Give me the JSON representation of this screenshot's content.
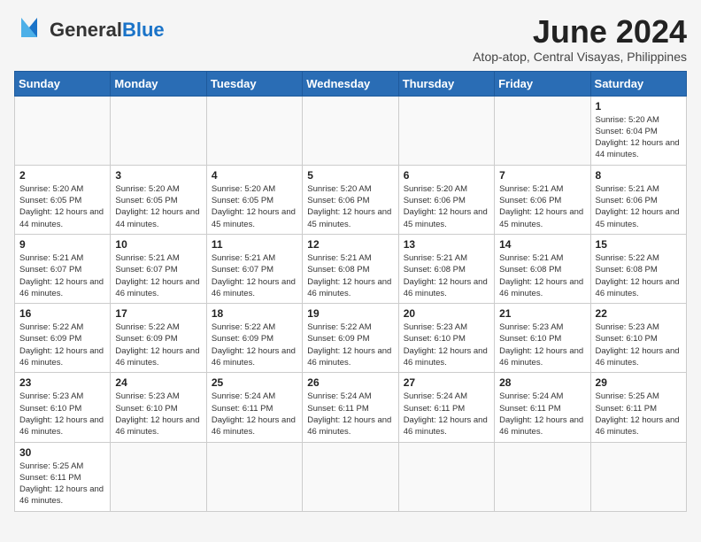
{
  "header": {
    "logo_general": "General",
    "logo_blue": "Blue",
    "month_title": "June 2024",
    "subtitle": "Atop-atop, Central Visayas, Philippines"
  },
  "days_of_week": [
    "Sunday",
    "Monday",
    "Tuesday",
    "Wednesday",
    "Thursday",
    "Friday",
    "Saturday"
  ],
  "weeks": [
    [
      {
        "day": "",
        "info": ""
      },
      {
        "day": "",
        "info": ""
      },
      {
        "day": "",
        "info": ""
      },
      {
        "day": "",
        "info": ""
      },
      {
        "day": "",
        "info": ""
      },
      {
        "day": "",
        "info": ""
      },
      {
        "day": "1",
        "info": "Sunrise: 5:20 AM\nSunset: 6:04 PM\nDaylight: 12 hours and 44 minutes."
      }
    ],
    [
      {
        "day": "2",
        "info": "Sunrise: 5:20 AM\nSunset: 6:05 PM\nDaylight: 12 hours and 44 minutes."
      },
      {
        "day": "3",
        "info": "Sunrise: 5:20 AM\nSunset: 6:05 PM\nDaylight: 12 hours and 44 minutes."
      },
      {
        "day": "4",
        "info": "Sunrise: 5:20 AM\nSunset: 6:05 PM\nDaylight: 12 hours and 45 minutes."
      },
      {
        "day": "5",
        "info": "Sunrise: 5:20 AM\nSunset: 6:06 PM\nDaylight: 12 hours and 45 minutes."
      },
      {
        "day": "6",
        "info": "Sunrise: 5:20 AM\nSunset: 6:06 PM\nDaylight: 12 hours and 45 minutes."
      },
      {
        "day": "7",
        "info": "Sunrise: 5:21 AM\nSunset: 6:06 PM\nDaylight: 12 hours and 45 minutes."
      },
      {
        "day": "8",
        "info": "Sunrise: 5:21 AM\nSunset: 6:06 PM\nDaylight: 12 hours and 45 minutes."
      }
    ],
    [
      {
        "day": "9",
        "info": "Sunrise: 5:21 AM\nSunset: 6:07 PM\nDaylight: 12 hours and 46 minutes."
      },
      {
        "day": "10",
        "info": "Sunrise: 5:21 AM\nSunset: 6:07 PM\nDaylight: 12 hours and 46 minutes."
      },
      {
        "day": "11",
        "info": "Sunrise: 5:21 AM\nSunset: 6:07 PM\nDaylight: 12 hours and 46 minutes."
      },
      {
        "day": "12",
        "info": "Sunrise: 5:21 AM\nSunset: 6:08 PM\nDaylight: 12 hours and 46 minutes."
      },
      {
        "day": "13",
        "info": "Sunrise: 5:21 AM\nSunset: 6:08 PM\nDaylight: 12 hours and 46 minutes."
      },
      {
        "day": "14",
        "info": "Sunrise: 5:21 AM\nSunset: 6:08 PM\nDaylight: 12 hours and 46 minutes."
      },
      {
        "day": "15",
        "info": "Sunrise: 5:22 AM\nSunset: 6:08 PM\nDaylight: 12 hours and 46 minutes."
      }
    ],
    [
      {
        "day": "16",
        "info": "Sunrise: 5:22 AM\nSunset: 6:09 PM\nDaylight: 12 hours and 46 minutes."
      },
      {
        "day": "17",
        "info": "Sunrise: 5:22 AM\nSunset: 6:09 PM\nDaylight: 12 hours and 46 minutes."
      },
      {
        "day": "18",
        "info": "Sunrise: 5:22 AM\nSunset: 6:09 PM\nDaylight: 12 hours and 46 minutes."
      },
      {
        "day": "19",
        "info": "Sunrise: 5:22 AM\nSunset: 6:09 PM\nDaylight: 12 hours and 46 minutes."
      },
      {
        "day": "20",
        "info": "Sunrise: 5:23 AM\nSunset: 6:10 PM\nDaylight: 12 hours and 46 minutes."
      },
      {
        "day": "21",
        "info": "Sunrise: 5:23 AM\nSunset: 6:10 PM\nDaylight: 12 hours and 46 minutes."
      },
      {
        "day": "22",
        "info": "Sunrise: 5:23 AM\nSunset: 6:10 PM\nDaylight: 12 hours and 46 minutes."
      }
    ],
    [
      {
        "day": "23",
        "info": "Sunrise: 5:23 AM\nSunset: 6:10 PM\nDaylight: 12 hours and 46 minutes."
      },
      {
        "day": "24",
        "info": "Sunrise: 5:23 AM\nSunset: 6:10 PM\nDaylight: 12 hours and 46 minutes."
      },
      {
        "day": "25",
        "info": "Sunrise: 5:24 AM\nSunset: 6:11 PM\nDaylight: 12 hours and 46 minutes."
      },
      {
        "day": "26",
        "info": "Sunrise: 5:24 AM\nSunset: 6:11 PM\nDaylight: 12 hours and 46 minutes."
      },
      {
        "day": "27",
        "info": "Sunrise: 5:24 AM\nSunset: 6:11 PM\nDaylight: 12 hours and 46 minutes."
      },
      {
        "day": "28",
        "info": "Sunrise: 5:24 AM\nSunset: 6:11 PM\nDaylight: 12 hours and 46 minutes."
      },
      {
        "day": "29",
        "info": "Sunrise: 5:25 AM\nSunset: 6:11 PM\nDaylight: 12 hours and 46 minutes."
      }
    ],
    [
      {
        "day": "30",
        "info": "Sunrise: 5:25 AM\nSunset: 6:11 PM\nDaylight: 12 hours and 46 minutes."
      },
      {
        "day": "",
        "info": ""
      },
      {
        "day": "",
        "info": ""
      },
      {
        "day": "",
        "info": ""
      },
      {
        "day": "",
        "info": ""
      },
      {
        "day": "",
        "info": ""
      },
      {
        "day": "",
        "info": ""
      }
    ]
  ]
}
